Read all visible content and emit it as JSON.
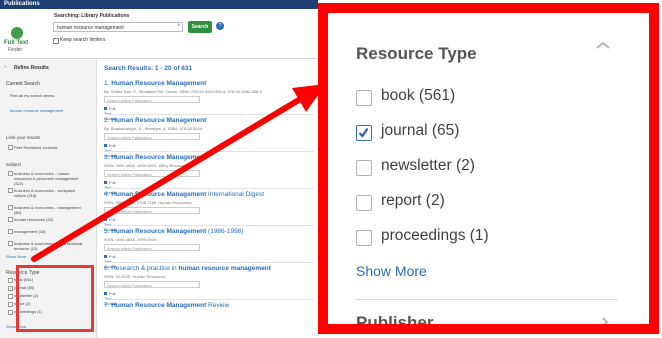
{
  "mini": {
    "topbar": "Publications",
    "logo": {
      "line1": "Full Text",
      "line2": "Finder"
    },
    "search": {
      "caption": "Searching: Library Publications",
      "query": "human resource management",
      "button": "Search",
      "keep_filters": "Keep search limiters"
    },
    "sidebar": {
      "refine": "Refine Results",
      "current_search": "Current Search",
      "find_all": "Find all my search terms:",
      "find_all_term": "human resource management",
      "limit_to": "Limit your results",
      "peer_reviewed": "Peer Reviewed Journals",
      "subject_header": "Subject",
      "subjects": [
        "business & economics - human resources & personnel management (322)",
        "business & economics - workplace culture (318)",
        "business & economics - management (80)",
        "human resources (32)",
        "management (18)",
        "business & economics - organizational behavior (13)"
      ],
      "show_more": "Show More",
      "resource_type": "Resource Type",
      "resource_items": [
        {
          "label": "book (561)",
          "checked": false
        },
        {
          "label": "journal (65)",
          "checked": true
        },
        {
          "label": "newsletter (2)",
          "checked": false
        },
        {
          "label": "report (2)",
          "checked": false
        },
        {
          "label": "proceedings (1)",
          "checked": false
        }
      ],
      "show_more_bottom": "Show More"
    },
    "results": {
      "header": "Search Results: 1 - 20 of 631",
      "search_within": "Search within Publication",
      "full_text": "Full Text Access",
      "items": [
        {
          "num": "1.",
          "title_bold": "Human Resource Management",
          "title_rest": "",
          "meta": "By: Subba Rao, P., Himalaya Pub. House. ISBN: 978-93-5024-550-8, 978-93-5083-358-0"
        },
        {
          "num": "2.",
          "title_bold": "Human Resource Management",
          "title_rest": "",
          "meta": "By: Bhattacharyya, D., Benarjee, A. ISBN: 978-93-5024"
        },
        {
          "num": "3.",
          "title_bold": "Human Resource Management",
          "title_rest": "",
          "meta": "ISSN: 0090-4848, 1099-050X. Wiley Resources."
        },
        {
          "num": "4.",
          "title_bold": "Human Resource Management",
          "title_rest": " International Digest",
          "meta": "ISSN: 0967-0734, 1758-7166. Human Resources."
        },
        {
          "num": "5.",
          "title_bold": "Human Resource Management",
          "title_rest": " (1986-1998)",
          "meta": "ISSN: 0090-4848, 1099-050X."
        },
        {
          "num": "6.",
          "title_bold": "human resource management",
          "title_rest": "Research & practice in ",
          "meta": "ISSN: 02-5105, Human Resources."
        },
        {
          "num": "7.",
          "title_bold": "Human Resource Management",
          "title_rest": " Review",
          "meta": ""
        }
      ]
    }
  },
  "zoom": {
    "header": "Resource Type",
    "items": [
      {
        "label": "book (561)",
        "checked": false
      },
      {
        "label": "journal (65)",
        "checked": true
      },
      {
        "label": "newsletter (2)",
        "checked": false
      },
      {
        "label": "report (2)",
        "checked": false
      },
      {
        "label": "proceedings (1)",
        "checked": false
      }
    ],
    "show_more": "Show More",
    "next_header": "Publisher"
  },
  "colors": {
    "highlight": "#ff0000",
    "link": "#2a6cb5",
    "accent_green": "#2f8f3f"
  },
  "icons": [
    "help-icon",
    "chevron-up-icon",
    "chevron-right-icon",
    "checkbox-icon",
    "arrow-annotation"
  ]
}
